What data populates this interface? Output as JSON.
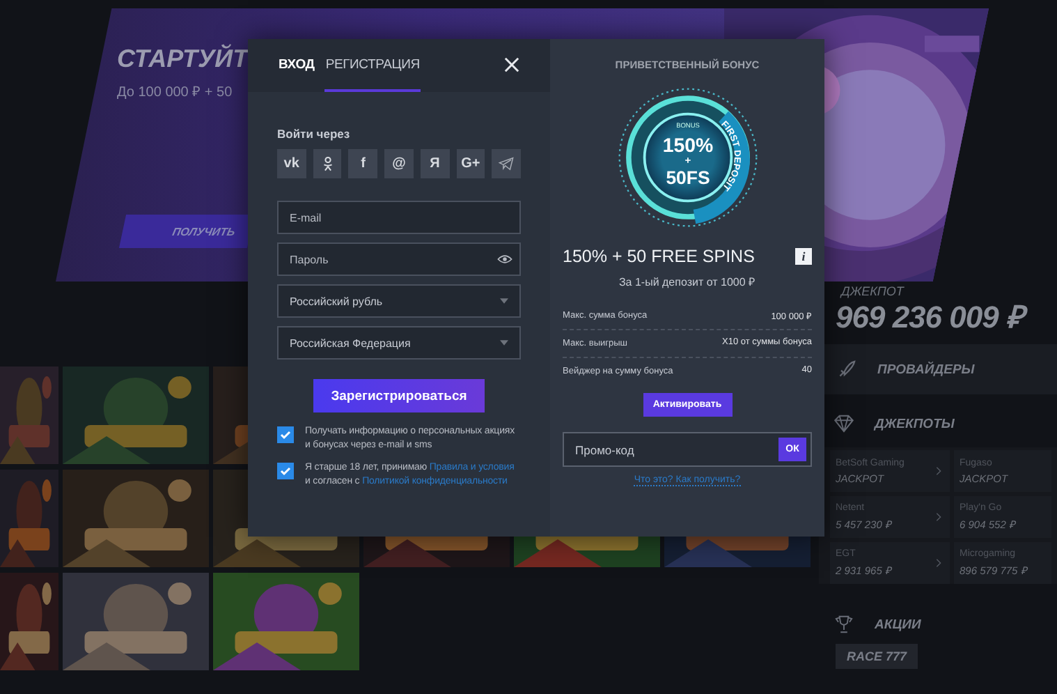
{
  "banner": {
    "title": "СТАРТУЙТ",
    "subtitle": "До 100 000 ₽ + 50",
    "button": "ПОЛУЧИТЬ"
  },
  "sidebar": {
    "jackpot_label": "ДЖЕКПОТ",
    "jackpot_value": "969 236 009 ₽",
    "providers": "ПРОВАЙДЕРЫ",
    "jackpots_title": "ДЖЕКПОТЫ",
    "jackpots": [
      {
        "provider": "BetSoft Gaming",
        "value": "JACKPOT"
      },
      {
        "provider": "Fugaso",
        "value": "JACKPOT"
      },
      {
        "provider": "Netent",
        "value": "5 457 230 ₽"
      },
      {
        "provider": "Play'n Go",
        "value": "6 904 552 ₽"
      },
      {
        "provider": "EGT",
        "value": "2 931 965 ₽"
      },
      {
        "provider": "Microgaming",
        "value": "896 579 775 ₽"
      }
    ],
    "promotions": "АКЦИИ",
    "race": "RACE 777"
  },
  "modal": {
    "tabs": [
      {
        "label": "ВХОД",
        "selected": false
      },
      {
        "label": "РЕГИСТРАЦИЯ",
        "selected": true
      }
    ],
    "social_label": "Войти через",
    "social": [
      {
        "kind": "text",
        "label": "vk"
      },
      {
        "kind": "ok"
      },
      {
        "kind": "text",
        "label": "f"
      },
      {
        "kind": "text",
        "label": "@"
      },
      {
        "kind": "text",
        "label": "Я"
      },
      {
        "kind": "text",
        "label": "G+"
      },
      {
        "kind": "telegram"
      }
    ],
    "fields": [
      {
        "kind": "input",
        "placeholder": "E-mail"
      },
      {
        "kind": "password",
        "placeholder": "Пароль"
      },
      {
        "kind": "select",
        "value": "Российский рубль"
      },
      {
        "kind": "select",
        "value": "Российская Федерация"
      }
    ],
    "submit": "Зарегистрироваться",
    "consents": [
      {
        "checked": true,
        "parts": [
          {
            "text": "Получать информацию о персональных акциях и бонусах через e-mail и sms",
            "link": false
          }
        ]
      },
      {
        "checked": true,
        "parts": [
          {
            "text": "Я старше 18 лет, принимаю ",
            "link": false
          },
          {
            "text": "Правила и условия",
            "link": true
          },
          {
            "text": " и согласен с ",
            "link": false
          },
          {
            "text": "Политикой конфиденциальности",
            "link": true
          }
        ]
      }
    ],
    "bonus": {
      "title": "ПРИВЕТСТВЕННЫЙ БОНУС",
      "badge": {
        "top": "BONUS",
        "main": "150%",
        "plus": "+",
        "fs": "50FS",
        "ring": "FIRST DEPOSIT"
      },
      "offer": "150% + 50 FREE SPINS",
      "info": "i",
      "subtitle": "За 1-ый депозит от 1000 ₽",
      "rows": [
        {
          "label": "Макс. сумма бонуса",
          "value": "100 000 ₽"
        },
        {
          "label": "Макс. выигрыш",
          "value": "X10 от суммы бонуса"
        },
        {
          "label": "Вейджер на сумму бонуса",
          "value": "40"
        }
      ],
      "activate": "Активировать",
      "promo_placeholder": "Промо-код",
      "ok": "ОК",
      "help": "Что это? Как получить?"
    }
  }
}
